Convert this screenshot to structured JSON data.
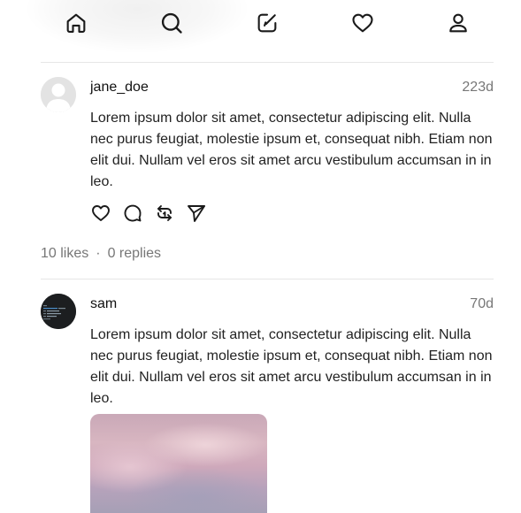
{
  "nav": {
    "items": [
      {
        "icon": "home-icon"
      },
      {
        "icon": "search-icon"
      },
      {
        "icon": "compose-icon"
      },
      {
        "icon": "heart-icon"
      },
      {
        "icon": "profile-icon"
      }
    ]
  },
  "posts": [
    {
      "username": "jane_doe",
      "time": "223d",
      "text": "Lorem ipsum dolor sit amet, consectetur adipiscing elit. Nulla nec purus feugiat, molestie ipsum et, consequat nibh. Etiam non elit dui. Nullam vel eros sit amet arcu vestibulum accumsan in in leo.",
      "likes": "10 likes",
      "separator": "·",
      "replies": "0 replies",
      "avatar": "default-avatar"
    },
    {
      "username": "sam",
      "time": "70d",
      "text": "Lorem ipsum dolor sit amet, consectetur adipiscing elit. Nulla nec purus feugiat, molestie ipsum et, consequat nibh. Etiam non elit dui. Nullam vel eros sit amet arcu vestibulum accumsan in in leo.",
      "avatar": "dark-terminal-avatar",
      "has_image": true
    }
  ],
  "colors": {
    "icon": "#1a1a1a",
    "muted": "#777777",
    "divider": "#e6e6e6"
  }
}
